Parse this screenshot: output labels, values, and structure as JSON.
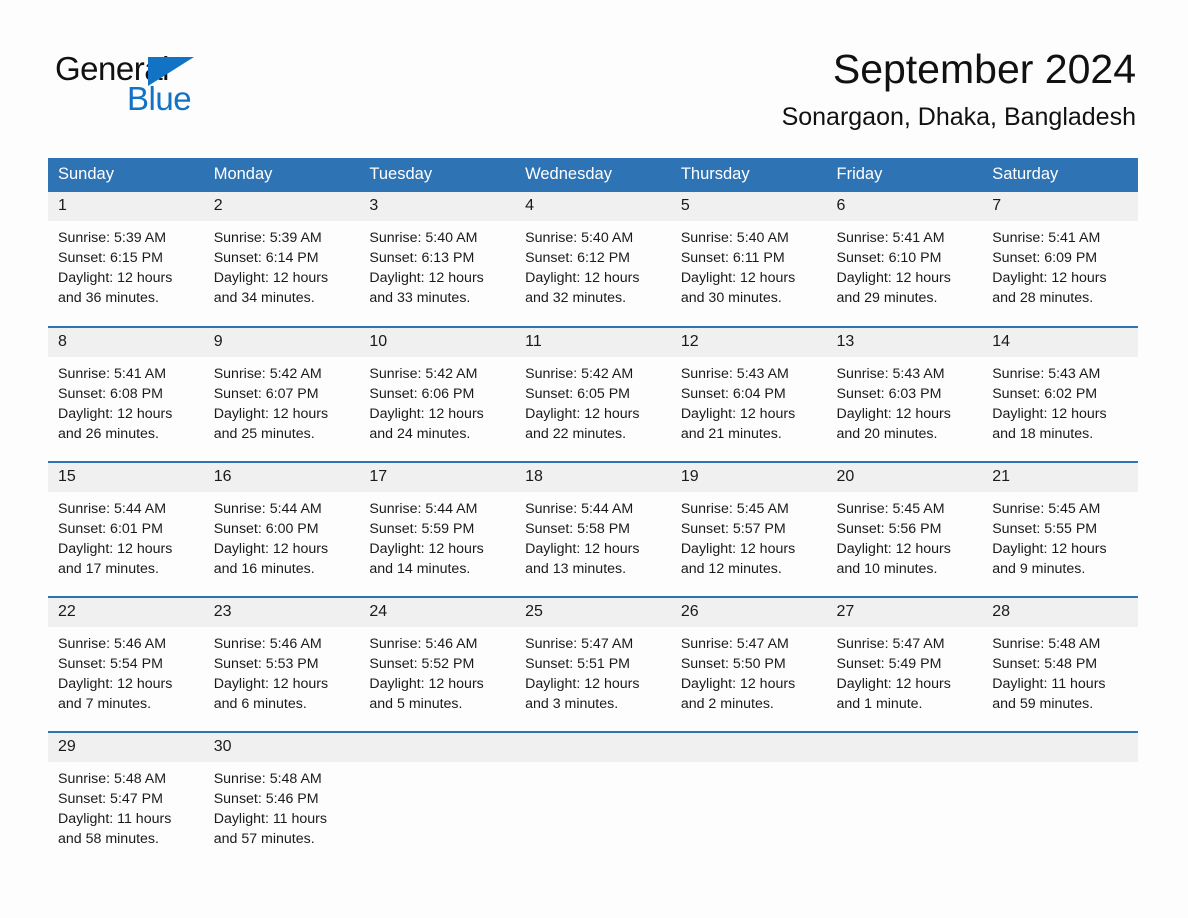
{
  "brand": {
    "word_one": "General",
    "word_two": "Blue",
    "triangle_icon": "triangle-icon",
    "accent_color": "#1273c4"
  },
  "header": {
    "title": "September 2024",
    "subtitle": "Sonargaon, Dhaka, Bangladesh"
  },
  "theme": {
    "header_blue": "#2e74b5",
    "daynum_gray": "#f0f0f0",
    "page_background": "#fdfdfd",
    "text": "#1a1a1a"
  },
  "weekdays": [
    "Sunday",
    "Monday",
    "Tuesday",
    "Wednesday",
    "Thursday",
    "Friday",
    "Saturday"
  ],
  "weeks": [
    [
      {
        "day": "1",
        "sunrise": "Sunrise: 5:39 AM",
        "sunset": "Sunset: 6:15 PM",
        "daylight_line1": "Daylight: 12 hours",
        "daylight_line2": "and 36 minutes."
      },
      {
        "day": "2",
        "sunrise": "Sunrise: 5:39 AM",
        "sunset": "Sunset: 6:14 PM",
        "daylight_line1": "Daylight: 12 hours",
        "daylight_line2": "and 34 minutes."
      },
      {
        "day": "3",
        "sunrise": "Sunrise: 5:40 AM",
        "sunset": "Sunset: 6:13 PM",
        "daylight_line1": "Daylight: 12 hours",
        "daylight_line2": "and 33 minutes."
      },
      {
        "day": "4",
        "sunrise": "Sunrise: 5:40 AM",
        "sunset": "Sunset: 6:12 PM",
        "daylight_line1": "Daylight: 12 hours",
        "daylight_line2": "and 32 minutes."
      },
      {
        "day": "5",
        "sunrise": "Sunrise: 5:40 AM",
        "sunset": "Sunset: 6:11 PM",
        "daylight_line1": "Daylight: 12 hours",
        "daylight_line2": "and 30 minutes."
      },
      {
        "day": "6",
        "sunrise": "Sunrise: 5:41 AM",
        "sunset": "Sunset: 6:10 PM",
        "daylight_line1": "Daylight: 12 hours",
        "daylight_line2": "and 29 minutes."
      },
      {
        "day": "7",
        "sunrise": "Sunrise: 5:41 AM",
        "sunset": "Sunset: 6:09 PM",
        "daylight_line1": "Daylight: 12 hours",
        "daylight_line2": "and 28 minutes."
      }
    ],
    [
      {
        "day": "8",
        "sunrise": "Sunrise: 5:41 AM",
        "sunset": "Sunset: 6:08 PM",
        "daylight_line1": "Daylight: 12 hours",
        "daylight_line2": "and 26 minutes."
      },
      {
        "day": "9",
        "sunrise": "Sunrise: 5:42 AM",
        "sunset": "Sunset: 6:07 PM",
        "daylight_line1": "Daylight: 12 hours",
        "daylight_line2": "and 25 minutes."
      },
      {
        "day": "10",
        "sunrise": "Sunrise: 5:42 AM",
        "sunset": "Sunset: 6:06 PM",
        "daylight_line1": "Daylight: 12 hours",
        "daylight_line2": "and 24 minutes."
      },
      {
        "day": "11",
        "sunrise": "Sunrise: 5:42 AM",
        "sunset": "Sunset: 6:05 PM",
        "daylight_line1": "Daylight: 12 hours",
        "daylight_line2": "and 22 minutes."
      },
      {
        "day": "12",
        "sunrise": "Sunrise: 5:43 AM",
        "sunset": "Sunset: 6:04 PM",
        "daylight_line1": "Daylight: 12 hours",
        "daylight_line2": "and 21 minutes."
      },
      {
        "day": "13",
        "sunrise": "Sunrise: 5:43 AM",
        "sunset": "Sunset: 6:03 PM",
        "daylight_line1": "Daylight: 12 hours",
        "daylight_line2": "and 20 minutes."
      },
      {
        "day": "14",
        "sunrise": "Sunrise: 5:43 AM",
        "sunset": "Sunset: 6:02 PM",
        "daylight_line1": "Daylight: 12 hours",
        "daylight_line2": "and 18 minutes."
      }
    ],
    [
      {
        "day": "15",
        "sunrise": "Sunrise: 5:44 AM",
        "sunset": "Sunset: 6:01 PM",
        "daylight_line1": "Daylight: 12 hours",
        "daylight_line2": "and 17 minutes."
      },
      {
        "day": "16",
        "sunrise": "Sunrise: 5:44 AM",
        "sunset": "Sunset: 6:00 PM",
        "daylight_line1": "Daylight: 12 hours",
        "daylight_line2": "and 16 minutes."
      },
      {
        "day": "17",
        "sunrise": "Sunrise: 5:44 AM",
        "sunset": "Sunset: 5:59 PM",
        "daylight_line1": "Daylight: 12 hours",
        "daylight_line2": "and 14 minutes."
      },
      {
        "day": "18",
        "sunrise": "Sunrise: 5:44 AM",
        "sunset": "Sunset: 5:58 PM",
        "daylight_line1": "Daylight: 12 hours",
        "daylight_line2": "and 13 minutes."
      },
      {
        "day": "19",
        "sunrise": "Sunrise: 5:45 AM",
        "sunset": "Sunset: 5:57 PM",
        "daylight_line1": "Daylight: 12 hours",
        "daylight_line2": "and 12 minutes."
      },
      {
        "day": "20",
        "sunrise": "Sunrise: 5:45 AM",
        "sunset": "Sunset: 5:56 PM",
        "daylight_line1": "Daylight: 12 hours",
        "daylight_line2": "and 10 minutes."
      },
      {
        "day": "21",
        "sunrise": "Sunrise: 5:45 AM",
        "sunset": "Sunset: 5:55 PM",
        "daylight_line1": "Daylight: 12 hours",
        "daylight_line2": "and 9 minutes."
      }
    ],
    [
      {
        "day": "22",
        "sunrise": "Sunrise: 5:46 AM",
        "sunset": "Sunset: 5:54 PM",
        "daylight_line1": "Daylight: 12 hours",
        "daylight_line2": "and 7 minutes."
      },
      {
        "day": "23",
        "sunrise": "Sunrise: 5:46 AM",
        "sunset": "Sunset: 5:53 PM",
        "daylight_line1": "Daylight: 12 hours",
        "daylight_line2": "and 6 minutes."
      },
      {
        "day": "24",
        "sunrise": "Sunrise: 5:46 AM",
        "sunset": "Sunset: 5:52 PM",
        "daylight_line1": "Daylight: 12 hours",
        "daylight_line2": "and 5 minutes."
      },
      {
        "day": "25",
        "sunrise": "Sunrise: 5:47 AM",
        "sunset": "Sunset: 5:51 PM",
        "daylight_line1": "Daylight: 12 hours",
        "daylight_line2": "and 3 minutes."
      },
      {
        "day": "26",
        "sunrise": "Sunrise: 5:47 AM",
        "sunset": "Sunset: 5:50 PM",
        "daylight_line1": "Daylight: 12 hours",
        "daylight_line2": "and 2 minutes."
      },
      {
        "day": "27",
        "sunrise": "Sunrise: 5:47 AM",
        "sunset": "Sunset: 5:49 PM",
        "daylight_line1": "Daylight: 12 hours",
        "daylight_line2": "and 1 minute."
      },
      {
        "day": "28",
        "sunrise": "Sunrise: 5:48 AM",
        "sunset": "Sunset: 5:48 PM",
        "daylight_line1": "Daylight: 11 hours",
        "daylight_line2": "and 59 minutes."
      }
    ],
    [
      {
        "day": "29",
        "sunrise": "Sunrise: 5:48 AM",
        "sunset": "Sunset: 5:47 PM",
        "daylight_line1": "Daylight: 11 hours",
        "daylight_line2": "and 58 minutes."
      },
      {
        "day": "30",
        "sunrise": "Sunrise: 5:48 AM",
        "sunset": "Sunset: 5:46 PM",
        "daylight_line1": "Daylight: 11 hours",
        "daylight_line2": "and 57 minutes."
      },
      {
        "day": "",
        "sunrise": "",
        "sunset": "",
        "daylight_line1": "",
        "daylight_line2": ""
      },
      {
        "day": "",
        "sunrise": "",
        "sunset": "",
        "daylight_line1": "",
        "daylight_line2": ""
      },
      {
        "day": "",
        "sunrise": "",
        "sunset": "",
        "daylight_line1": "",
        "daylight_line2": ""
      },
      {
        "day": "",
        "sunrise": "",
        "sunset": "",
        "daylight_line1": "",
        "daylight_line2": ""
      },
      {
        "day": "",
        "sunrise": "",
        "sunset": "",
        "daylight_line1": "",
        "daylight_line2": ""
      }
    ]
  ]
}
